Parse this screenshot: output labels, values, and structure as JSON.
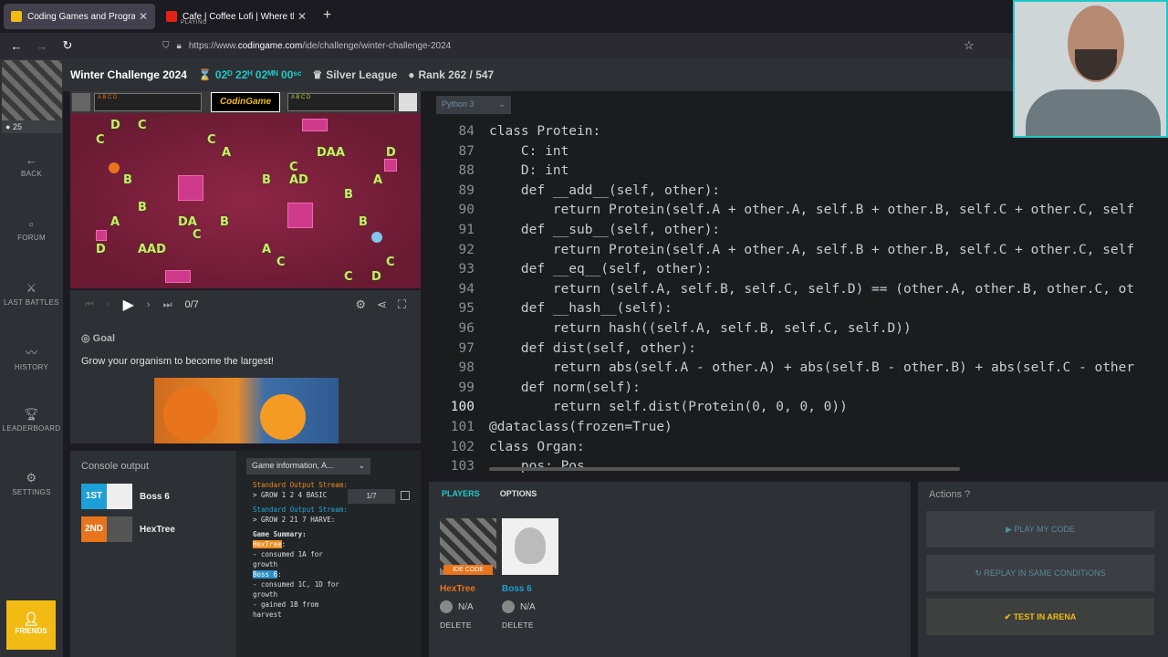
{
  "browser": {
    "tabs": [
      {
        "title": "Coding Games and Programming",
        "sub": ""
      },
      {
        "title": "Cafe | Coffee Lofi | Where the He",
        "sub": "PLAYING"
      }
    ],
    "url_prefix": "https://www.",
    "url_domain": "codingame.com",
    "url_path": "/ide/challenge/winter-challenge-2024"
  },
  "sidebar": {
    "rank_badge": "25",
    "items": [
      {
        "label": "BACK",
        "icon": "back-arrow-icon"
      },
      {
        "label": "FORUM",
        "icon": "forum-icon"
      },
      {
        "label": "LAST BATTLES",
        "icon": "battles-icon"
      },
      {
        "label": "HISTORY",
        "icon": "history-icon"
      },
      {
        "label": "LEADERBOARD",
        "icon": "trophy-icon"
      },
      {
        "label": "SETTINGS",
        "icon": "gear-icon"
      }
    ],
    "friends": "FRIENDS"
  },
  "header": {
    "title": "Winter Challenge 2024",
    "timer": "02ᴰ 22ᴴ 02ᴹᴺ 00ˢᶜ",
    "league": "Silver League",
    "rank": "Rank 262 / 547"
  },
  "game": {
    "logo": "CodinGame",
    "left_plate": "A B C D",
    "right_plate": "A B C D",
    "frame": "0/7"
  },
  "goal": {
    "title": "Goal",
    "text": "Grow your organism to become the largest!"
  },
  "console": {
    "title": "Console output",
    "players": [
      {
        "place": "1ST",
        "name": "Boss 6",
        "color": "#1e9fd8"
      },
      {
        "place": "2ND",
        "name": "HexTree",
        "color": "#e8741c"
      }
    ],
    "select": "Game information, A...",
    "pager": "1/7",
    "log": {
      "h1": "Standard Output Stream:",
      "l1": "> GROW 1 2 4 BASIC",
      "h2": "Standard Output Stream:",
      "l2": "> GROW 2 21 7 HARVE:",
      "summary": "Game Summary:",
      "p1": "HexTree",
      "p1l": "- consumed 1A for growth",
      "p2": "Boss 6",
      "p2l": "- consumed 1C, 1D for growth",
      "p2l2": "- gained 1B from harvest"
    }
  },
  "editor": {
    "language": "Python 3",
    "lines": [
      {
        "n": "84",
        "t": "class Protein:"
      },
      {
        "n": "87",
        "t": "    C: int"
      },
      {
        "n": "88",
        "t": "    D: int"
      },
      {
        "n": "89",
        "t": "    def __add__(self, other):"
      },
      {
        "n": "90",
        "t": "        return Protein(self.A + other.A, self.B + other.B, self.C + other.C, self"
      },
      {
        "n": "91",
        "t": "    def __sub__(self, other):"
      },
      {
        "n": "92",
        "t": "        return Protein(self.A + other.A, self.B + other.B, self.C + other.C, self"
      },
      {
        "n": "93",
        "t": "    def __eq__(self, other):"
      },
      {
        "n": "94",
        "t": "        return (self.A, self.B, self.C, self.D) == (other.A, other.B, other.C, ot"
      },
      {
        "n": "95",
        "t": "    def __hash__(self):"
      },
      {
        "n": "96",
        "t": "        return hash((self.A, self.B, self.C, self.D))"
      },
      {
        "n": "97",
        "t": "    def dist(self, other):"
      },
      {
        "n": "98",
        "t": "        return abs(self.A - other.A) + abs(self.B - other.B) + abs(self.C - other"
      },
      {
        "n": "99",
        "t": "    def norm(self):"
      },
      {
        "n": "100",
        "t": "        return self.dist(Protein(0, 0, 0, 0))"
      },
      {
        "n": "101",
        "t": "@dataclass(frozen=True)"
      },
      {
        "n": "102",
        "t": "class Organ:"
      },
      {
        "n": "103",
        "t": "    pos: Pos"
      }
    ]
  },
  "players_panel": {
    "tab_players": "PLAYERS",
    "tab_options": "OPTIONS",
    "p1": {
      "name": "HexTree",
      "score": "N/A",
      "delete": "DELETE",
      "badge": "IDE CODE"
    },
    "p2": {
      "name": "Boss 6",
      "score": "N/A",
      "delete": "DELETE"
    }
  },
  "actions": {
    "title": "Actions",
    "play": "PLAY MY CODE",
    "replay": "REPLAY IN SAME CONDITIONS",
    "arena": "TEST IN ARENA"
  }
}
